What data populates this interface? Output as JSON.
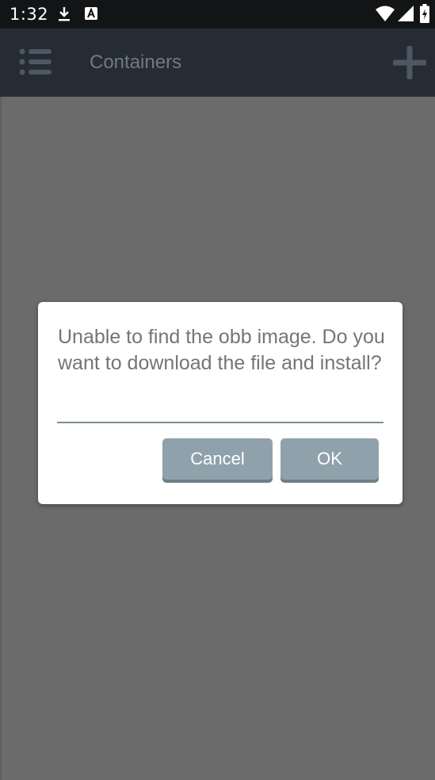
{
  "status_bar": {
    "time": "1:32",
    "icons": [
      "download-icon",
      "a-notification-icon",
      "wifi-icon",
      "signal-icon",
      "battery-icon"
    ]
  },
  "app_bar": {
    "title": "Containers",
    "menu_icon": "list-menu-icon",
    "add_icon": "plus-icon"
  },
  "dialog": {
    "message": "Unable to find the obb image. Do you want to download the file and install?",
    "cancel_label": "Cancel",
    "ok_label": "OK"
  },
  "colors": {
    "status_bar": "#121416",
    "app_bar": "#252c34",
    "scrim": "#6b6b6b",
    "button": "#8fa2ac",
    "divider": "#7b8e99"
  }
}
